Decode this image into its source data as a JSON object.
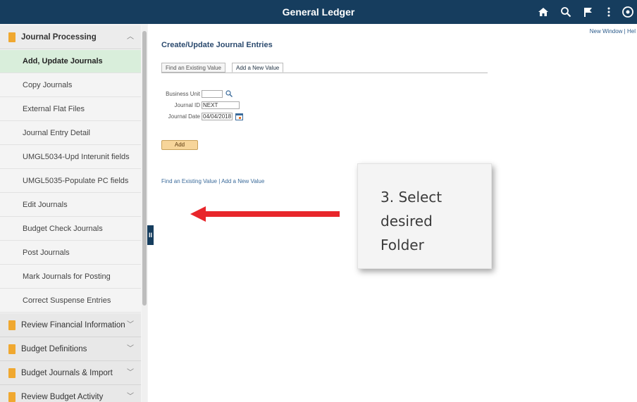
{
  "header": {
    "title": "General Ledger",
    "icons": [
      "home-icon",
      "search-icon",
      "flag-icon",
      "more-vertical-icon",
      "navbar-icon"
    ],
    "background": "#163d5e"
  },
  "sidebar": {
    "group_open": "Journal Processing",
    "items": [
      "Add, Update Journals",
      "Copy Journals",
      "External Flat Files",
      "Journal Entry Detail",
      "UMGL5034-Upd Interunit fields",
      "UMGL5035-Populate PC fields",
      "Edit Journals",
      "Budget Check Journals",
      "Post Journals",
      "Mark Journals for Posting",
      "Correct Suspense Entries"
    ],
    "groups_closed": [
      "Review Financial Information",
      "Budget Definitions",
      "Budget Journals & Import",
      "Review Budget Activity"
    ],
    "active_color": "#d9eedb",
    "folder_color": "#f0a830"
  },
  "main": {
    "new_window": "New Window | Hel",
    "page_title": "Create/Update Journal Entries",
    "tabs": [
      "Find an Existing Value",
      "Add a New Value"
    ],
    "form": {
      "business_unit_label": "Business Unit",
      "business_unit_value": "",
      "journal_id_label": "Journal ID",
      "journal_id_value": "NEXT",
      "journal_date_label": "Journal Date",
      "journal_date_value": "04/04/2018"
    },
    "add_button": "Add",
    "bottom_links": "Find an Existing Value | Add a New Value"
  },
  "callout": {
    "text": "3. Select\ndesired\nFolder",
    "arrow_color": "#e8262b"
  }
}
